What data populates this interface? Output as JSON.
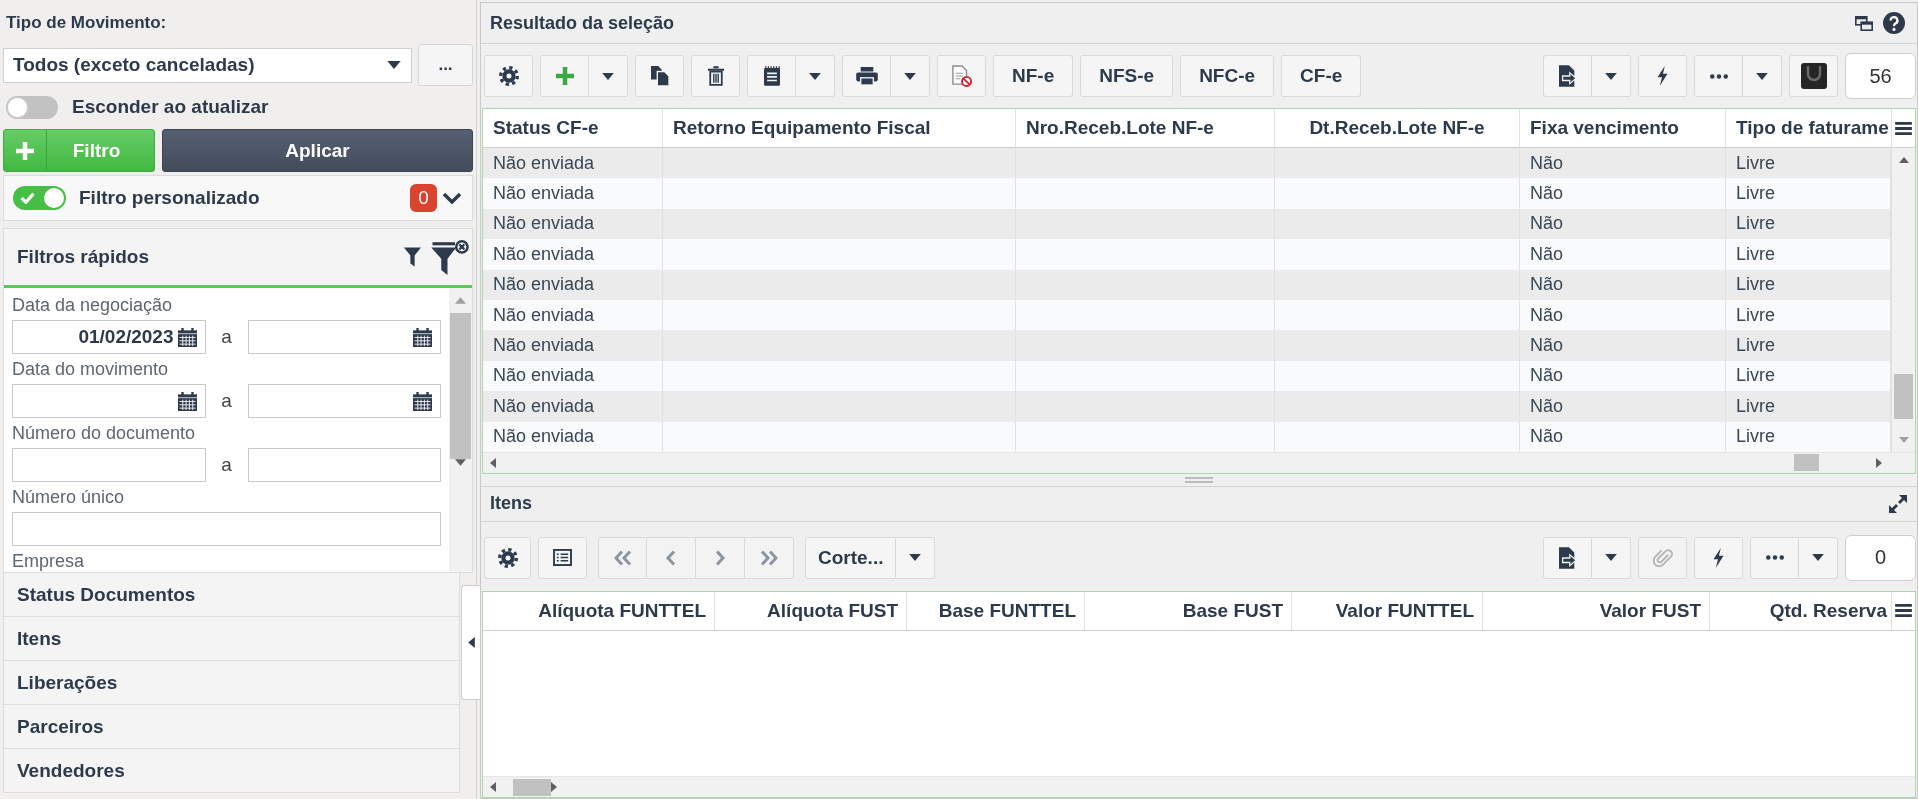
{
  "filter_panel": {
    "movement_type": {
      "label": "Tipo de Movimento:",
      "value": "Todos (exceto canceladas)",
      "more_button": "..."
    },
    "hide_on_update": {
      "label": "Esconder ao atualizar",
      "on": false
    },
    "add_filter_button": "Filtro",
    "apply_button": "Aplicar",
    "custom_filter": {
      "label": "Filtro personalizado",
      "on": true,
      "count": "0"
    },
    "quick_filters": {
      "title": "Filtros rápidos",
      "fields": [
        {
          "kind": "date_range",
          "label": "Data da negociação",
          "from": "01/02/2023",
          "separator": "a"
        },
        {
          "kind": "date_range",
          "label": "Data do movimento",
          "separator": "a"
        },
        {
          "kind": "range",
          "label": "Número do documento",
          "separator": "a"
        },
        {
          "kind": "text",
          "label": "Número único"
        },
        {
          "kind": "label_only",
          "label": "Empresa"
        }
      ]
    },
    "sections": [
      "Status Documentos",
      "Itens",
      "Liberações",
      "Parceiros",
      "Vendedores"
    ]
  },
  "results_panel": {
    "title": "Resultado da seleção",
    "document_buttons": [
      "NF-e",
      "NFS-e",
      "NFC-e",
      "CF-e"
    ],
    "record_count": "56",
    "table": {
      "columns": [
        "Status CF-e",
        "Retorno Equipamento Fiscal",
        "Nro.Receb.Lote NF-e",
        "Dt.Receb.Lote NF-e",
        "Fixa vencimento",
        "Tipo de faturame"
      ],
      "rows": [
        [
          "Não enviada",
          null,
          null,
          null,
          "Não",
          "Livre"
        ],
        [
          "Não enviada",
          null,
          null,
          null,
          "Não",
          "Livre"
        ],
        [
          "Não enviada",
          null,
          null,
          null,
          "Não",
          "Livre"
        ],
        [
          "Não enviada",
          null,
          null,
          null,
          "Não",
          "Livre"
        ],
        [
          "Não enviada",
          null,
          null,
          null,
          "Não",
          "Livre"
        ],
        [
          "Não enviada",
          null,
          null,
          null,
          "Não",
          "Livre"
        ],
        [
          "Não enviada",
          null,
          null,
          null,
          "Não",
          "Livre"
        ],
        [
          "Não enviada",
          null,
          null,
          null,
          "Não",
          "Livre"
        ],
        [
          "Não enviada",
          null,
          null,
          null,
          "Não",
          "Livre"
        ],
        [
          "Não enviada",
          null,
          null,
          null,
          "Não",
          "Livre"
        ]
      ]
    }
  },
  "items_panel": {
    "title": "Itens",
    "navigation": {
      "disabled": true
    },
    "layout_button": "Corte...",
    "attach": {
      "disabled": true
    },
    "record_count": "0",
    "table": {
      "columns": [
        "Alíquota FUNTTEL",
        "Alíquota FUST",
        "Base FUNTTEL",
        "Base FUST",
        "Valor FUNTTEL",
        "Valor FUST",
        "Qtd. Reserva"
      ]
    }
  }
}
